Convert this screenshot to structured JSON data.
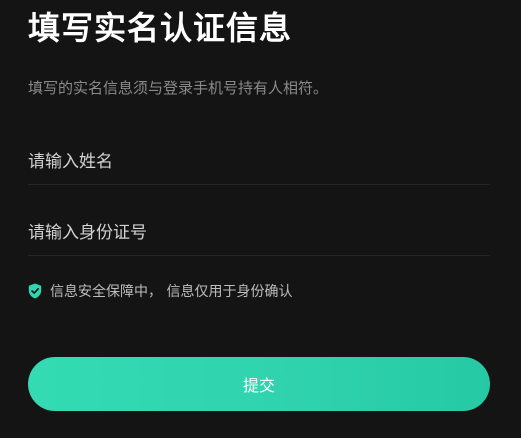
{
  "header": {
    "title": "填写实名认证信息",
    "subtitle": "填写的实名信息须与登录手机号持有人相符。"
  },
  "form": {
    "name_placeholder": "请输入姓名",
    "name_value": "",
    "id_placeholder": "请输入身份证号",
    "id_value": ""
  },
  "notice": {
    "icon": "shield-check-icon",
    "text": "信息安全保障中， 信息仅用于身份确认"
  },
  "submit": {
    "label": "提交"
  },
  "colors": {
    "background": "#141414",
    "accent": "#2fd5af",
    "subtitle_text": "#8a8a8a",
    "divider": "#262626"
  }
}
